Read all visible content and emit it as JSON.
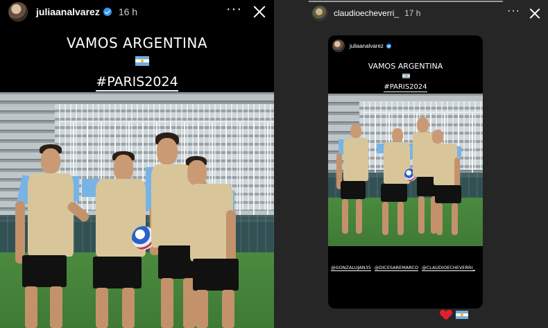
{
  "left_story": {
    "username": "juliaanalvarez",
    "time": "16 h",
    "more_label": "···",
    "title": "VAMOS ARGENTINA",
    "hashtag": "#PARIS2024",
    "flag_icon": "argentina-flag-icon"
  },
  "right_story": {
    "username": "claudioecheverri_",
    "time": "17 h",
    "more_label": "···",
    "card": {
      "username": "juliaanalvarez",
      "title": "VAMOS ARGENTINA",
      "hashtag": "#PARIS2024",
      "mentions": [
        "@GONZALUJAN35",
        "@DICESAREMARCO",
        "@CLAUDIOECHEVERRI_"
      ]
    },
    "reaction_icons": [
      "red-heart-icon",
      "argentina-flag-icon"
    ]
  },
  "colors": {
    "story_background": "#000000",
    "side_panel": "#262626",
    "verified_badge": "#3897f0",
    "jersey": "#d8c69a",
    "sleeves": "#78b3e6",
    "heart": "#e0202e"
  }
}
